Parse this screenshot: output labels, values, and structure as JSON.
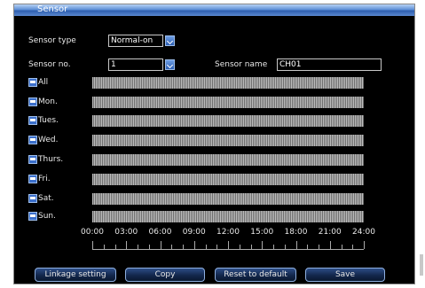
{
  "window": {
    "title": "Sensor"
  },
  "sensor_type": {
    "label": "Sensor type",
    "value": "Normal-on"
  },
  "sensor_no": {
    "label": "Sensor no.",
    "value": "1"
  },
  "sensor_name": {
    "label": "Sensor name",
    "value": "CH01"
  },
  "schedule": {
    "days": [
      "All",
      "Mon.",
      "Tues.",
      "Wed.",
      "Thurs.",
      "Fri.",
      "Sat.",
      "Sun."
    ],
    "time_labels": [
      "00:00",
      "03:00",
      "06:00",
      "09:00",
      "12:00",
      "15:00",
      "18:00",
      "21:00",
      "24:00"
    ]
  },
  "buttons": {
    "linkage": "Linkage setting",
    "copy": "Copy",
    "reset": "Reset to default",
    "save": "Save"
  }
}
